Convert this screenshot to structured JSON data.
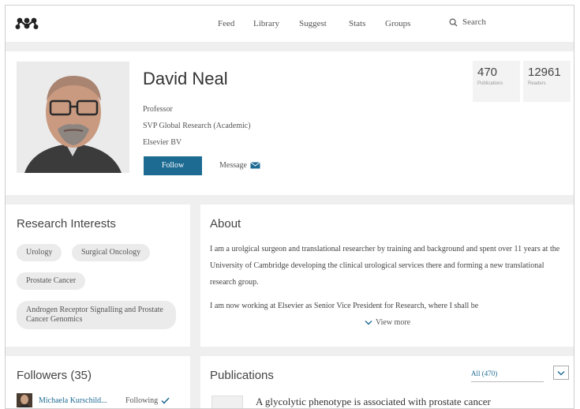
{
  "nav": {
    "items": [
      "Feed",
      "Library",
      "Suggest",
      "Stats",
      "Groups"
    ],
    "search_label": "Search"
  },
  "profile": {
    "name": "David Neal",
    "roles": [
      "Professor",
      "SVP Global Research (Academic)",
      "Elsevier BV"
    ],
    "follow_label": "Follow",
    "message_label": "Message",
    "stats": [
      {
        "value": "470",
        "label": "Publications"
      },
      {
        "value": "12961",
        "label": "Readers"
      }
    ]
  },
  "interests": {
    "title": "Research Interests",
    "chips": [
      "Urology",
      "Surgical Oncology",
      "Prostate Cancer",
      "Androgen Receptor Signalling and Prostate Cancer Genomics"
    ]
  },
  "about": {
    "title": "About",
    "paragraph1": "I am a urolgical surgeon and translational researcher by training and background and spent over 11 years at the University of Cambridge developing the clinical urological services there and forming a new translational research group.",
    "paragraph2": "I am now working at Elsevier as Senior Vice President for Research, where I shall be",
    "view_more": "View more"
  },
  "followers": {
    "title": "Followers (35)",
    "items": [
      {
        "name": "Michaela Kurschild...",
        "status": "Following"
      }
    ]
  },
  "publications": {
    "title": "Publications",
    "filter_label": "All (470)",
    "items": [
      {
        "title": "A glycolytic phenotype is associated with prostate cancer"
      }
    ]
  },
  "colors": {
    "accent": "#1d6b93",
    "background": "#efefef",
    "card": "#ffffff",
    "chip": "#ebebeb"
  }
}
